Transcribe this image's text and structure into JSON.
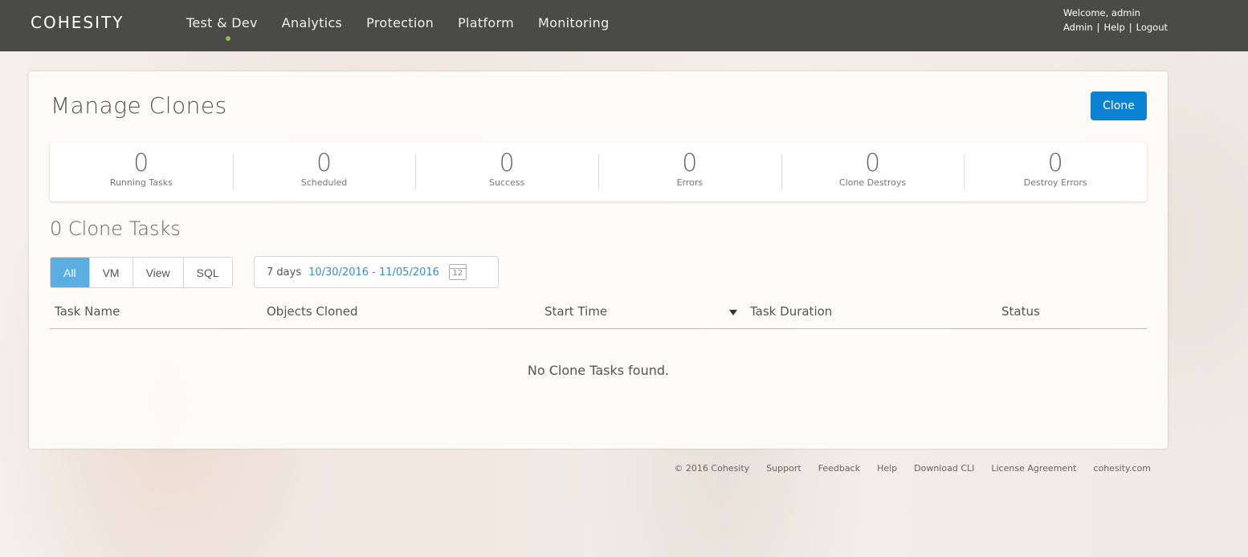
{
  "brand": {
    "logo_text": "COHESITY"
  },
  "nav": {
    "items": [
      {
        "label": "Test & Dev",
        "active": true
      },
      {
        "label": "Analytics"
      },
      {
        "label": "Protection"
      },
      {
        "label": "Platform"
      },
      {
        "label": "Monitoring"
      }
    ],
    "active_color": "#8bbf3f"
  },
  "user": {
    "welcome": "Welcome, admin",
    "links": [
      "Admin",
      "Help",
      "Logout"
    ],
    "separator": "|"
  },
  "page": {
    "title": "Manage Clones",
    "clone_button": "Clone",
    "accent_color": "#0b81d2"
  },
  "stats": [
    {
      "value": "0",
      "label": "Running Tasks"
    },
    {
      "value": "0",
      "label": "Scheduled"
    },
    {
      "value": "0",
      "label": "Success"
    },
    {
      "value": "0",
      "label": "Errors"
    },
    {
      "value": "0",
      "label": "Clone Destroys"
    },
    {
      "value": "0",
      "label": "Destroy Errors"
    }
  ],
  "tasks": {
    "title": "0 Clone Tasks",
    "filters": [
      "All",
      "VM",
      "View",
      "SQL"
    ],
    "active_filter": "All",
    "date_filter": {
      "days": "7 days",
      "range": "10/30/2016 - 11/05/2016",
      "icon": "calendar-icon",
      "icon_text": "12"
    },
    "columns": [
      "Task Name",
      "Objects Cloned",
      "Start Time",
      "Task Duration",
      "Status"
    ],
    "empty_message": "No Clone Tasks found."
  },
  "footer": {
    "copyright": "© 2016 Cohesity",
    "links": [
      "Support",
      "Feedback",
      "Help",
      "Download CLI",
      "License Agreement",
      "cohesity.com"
    ]
  }
}
